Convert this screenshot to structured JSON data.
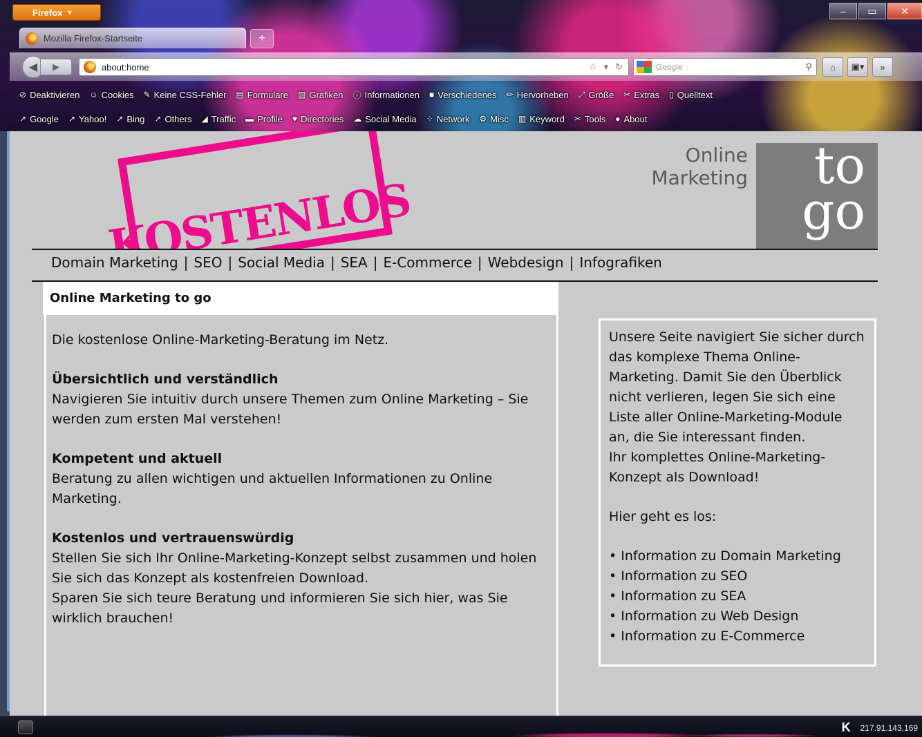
{
  "browser": {
    "menu_label": "Firefox",
    "tab_title": "Mozilla Firefox-Startseite",
    "url": "about:home",
    "search_placeholder": "Google",
    "window_buttons": [
      "minimize",
      "maximize",
      "close"
    ]
  },
  "toolbar1": [
    {
      "label": "Deaktivieren",
      "icon": "no-entry-icon"
    },
    {
      "label": "Cookies",
      "icon": "user-icon"
    },
    {
      "label": "Keine CSS-Fehler",
      "icon": "brush-icon"
    },
    {
      "label": "Formulare",
      "icon": "form-icon"
    },
    {
      "label": "Grafiken",
      "icon": "image-icon"
    },
    {
      "label": "Informationen",
      "icon": "info-icon"
    },
    {
      "label": "Verschiedenes",
      "icon": "misc-icon"
    },
    {
      "label": "Hervorheben",
      "icon": "pencil-icon"
    },
    {
      "label": "Größe",
      "icon": "resize-icon"
    },
    {
      "label": "Extras",
      "icon": "tools-icon"
    },
    {
      "label": "Quelltext",
      "icon": "source-icon"
    }
  ],
  "toolbar2": [
    {
      "label": "Google",
      "icon": "wand-icon"
    },
    {
      "label": "Yahoo!",
      "icon": "wand-icon"
    },
    {
      "label": "Bing",
      "icon": "wand-icon"
    },
    {
      "label": "Others",
      "icon": "wand-icon"
    },
    {
      "label": "Traffic",
      "icon": "chart-icon"
    },
    {
      "label": "Profile",
      "icon": "profile-icon"
    },
    {
      "label": "Directories",
      "icon": "heart-icon"
    },
    {
      "label": "Social Media",
      "icon": "cloud-icon"
    },
    {
      "label": "Network",
      "icon": "network-icon"
    },
    {
      "label": "Misc",
      "icon": "gear-icon"
    },
    {
      "label": "Keyword",
      "icon": "keyword-icon"
    },
    {
      "label": "Tools",
      "icon": "tools-icon"
    },
    {
      "label": "About",
      "icon": "about-icon"
    }
  ],
  "site": {
    "stamp_text": "KOSTENLOS",
    "brand_line1": "Online",
    "brand_line2": "Marketing",
    "brand_box_line1": "to",
    "brand_box_line2": "go",
    "nav": [
      "Domain Marketing",
      "SEO",
      "Social Media",
      "SEA",
      "E-Commerce",
      "Webdesign",
      "Infografiken"
    ],
    "main": {
      "title": "Online Marketing to go",
      "intro": "Die kostenlose Online-Marketing-Beratung im Netz.",
      "sections": [
        {
          "heading": "Übersichtlich und verständlich",
          "text": "Navigieren Sie intuitiv durch unsere Themen zum Online Marketing – Sie werden zum ersten Mal verstehen!"
        },
        {
          "heading": "Kompetent und aktuell",
          "text": "Beratung zu allen wichtigen und aktuellen Informationen zu Online Marketing."
        },
        {
          "heading": "Kostenlos und vertrauenswürdig",
          "text": "Stellen Sie sich Ihr Online-Marketing-Konzept selbst zusammen und holen Sie sich das Konzept als kostenfreien Download.",
          "text2": "Sparen Sie sich teure Beratung und informieren Sie sich hier, was Sie wirklich brauchen!"
        }
      ]
    },
    "sidebar": {
      "text1": "Unsere Seite navigiert Sie sicher durch das komplexe Thema Online-Marketing. Damit Sie den Überblick nicht verlieren, legen Sie sich eine Liste aller Online-Marketing-Module an, die Sie interessant finden.",
      "text2": "Ihr komplettes Online-Marketing-Konzept als Download!",
      "lead": "Hier geht es los:",
      "links": [
        "• Information zu Domain Marketing",
        "• Information zu SEO",
        "• Information zu SEA",
        "• Information zu Web Design",
        "• Information zu E-Commerce"
      ]
    }
  },
  "taskbar": {
    "tray_text": "217.91.143.169",
    "tray_logo": "K"
  },
  "colors": {
    "stamp": "#ec0c8c",
    "page_bg": "#cacaca",
    "brand_box": "#7d7d7d",
    "brand_text": "#5a5a5a",
    "firefox_button": "#e8861f"
  }
}
